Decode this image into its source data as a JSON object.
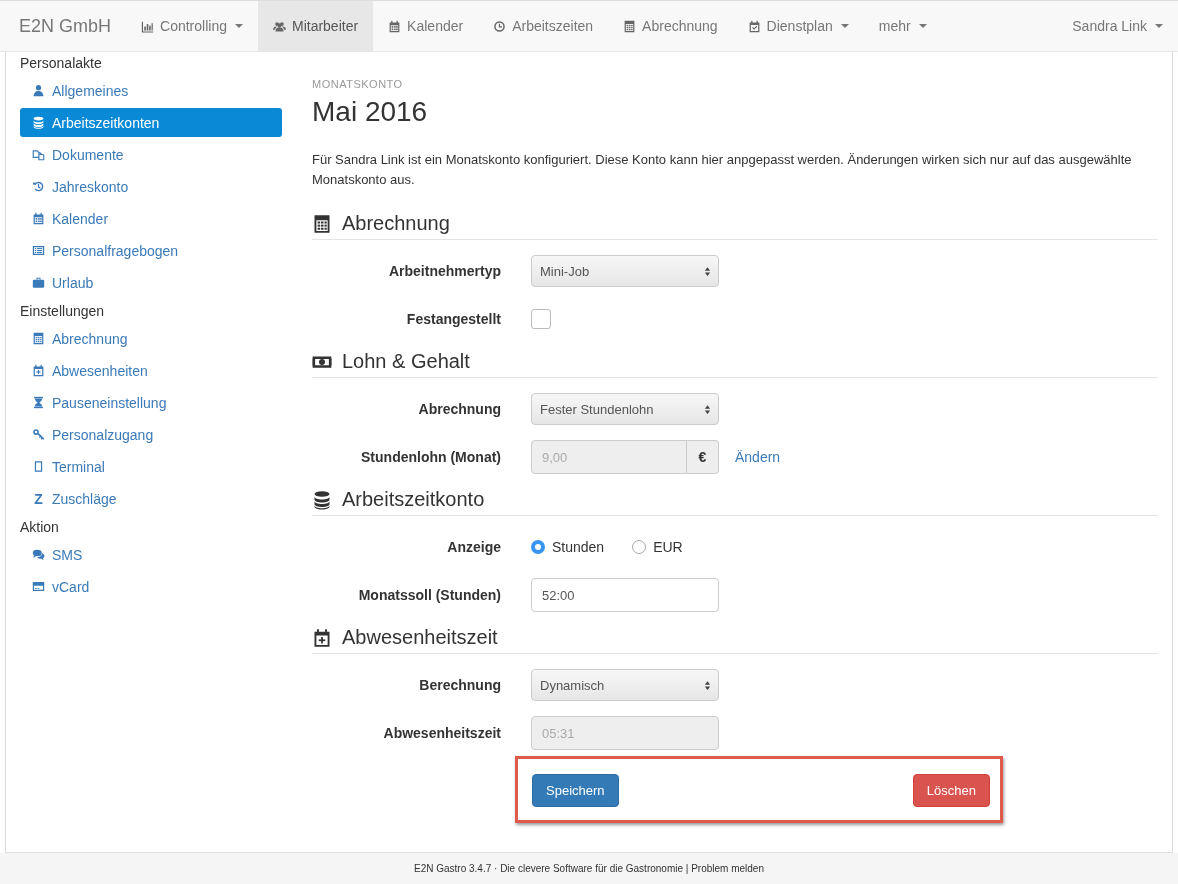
{
  "navbar": {
    "brand": "E2N GmbH",
    "items": [
      {
        "label": "Controlling",
        "dropdown": true,
        "selected": false
      },
      {
        "label": "Mitarbeiter",
        "dropdown": false,
        "selected": true
      },
      {
        "label": "Kalender",
        "dropdown": false,
        "selected": false
      },
      {
        "label": "Arbeitszeiten",
        "dropdown": false,
        "selected": false
      },
      {
        "label": "Abrechnung",
        "dropdown": false,
        "selected": false
      },
      {
        "label": "Dienstplan",
        "dropdown": true,
        "selected": false
      },
      {
        "label": "mehr",
        "dropdown": true,
        "selected": false
      }
    ],
    "user": {
      "label": "Sandra Link",
      "dropdown": true
    }
  },
  "sidebar": {
    "groups": [
      {
        "title": "Personalakte",
        "items": [
          {
            "label": "Allgemeines",
            "selected": false
          },
          {
            "label": "Arbeitszeitkonten",
            "selected": true
          },
          {
            "label": "Dokumente",
            "selected": false
          },
          {
            "label": "Jahreskonto",
            "selected": false
          },
          {
            "label": "Kalender",
            "selected": false
          },
          {
            "label": "Personalfragebogen",
            "selected": false
          },
          {
            "label": "Urlaub",
            "selected": false
          }
        ]
      },
      {
        "title": "Einstellungen",
        "items": [
          {
            "label": "Abrechnung",
            "selected": false
          },
          {
            "label": "Abwesenheiten",
            "selected": false
          },
          {
            "label": "Pauseneinstellung",
            "selected": false
          },
          {
            "label": "Personalzugang",
            "selected": false
          },
          {
            "label": "Terminal",
            "selected": false
          },
          {
            "label": "Zuschläge",
            "selected": false,
            "glyph": "Z"
          }
        ]
      },
      {
        "title": "Aktion",
        "items": [
          {
            "label": "SMS",
            "selected": false
          },
          {
            "label": "vCard",
            "selected": false
          }
        ]
      }
    ]
  },
  "page": {
    "eyebrow": "MONATSKONTO",
    "title": "Mai 2016",
    "intro": "Für Sandra Link ist ein Monatskonto konfiguriert. Diese Konto kann hier anpgepasst werden. Änderungen wirken sich nur auf das ausgewählte Monatskonto aus.",
    "sections": [
      {
        "title": "Abrechnung",
        "fields": [
          {
            "kind": "select",
            "label": "Arbeitnehmertyp",
            "value": "Mini-Job"
          },
          {
            "kind": "checkbox",
            "label": "Festangestellt",
            "checked": false
          }
        ]
      },
      {
        "title": "Lohn & Gehalt",
        "fields": [
          {
            "kind": "select",
            "label": "Abrechnung",
            "value": "Fester Stundenlohn"
          },
          {
            "kind": "input",
            "label": "Stundenlohn (Monat)",
            "value": "9,00",
            "disabled": true,
            "addon": "€",
            "link": "Ändern"
          }
        ]
      },
      {
        "title": "Arbeitszeitkonto",
        "fields": [
          {
            "kind": "radio",
            "label": "Anzeige",
            "options": [
              {
                "label": "Stunden",
                "selected": true
              },
              {
                "label": "EUR",
                "selected": false
              }
            ]
          },
          {
            "kind": "input",
            "label": "Monatssoll (Stunden)",
            "value": "52:00",
            "disabled": false
          }
        ]
      },
      {
        "title": "Abwesenheitszeit",
        "fields": [
          {
            "kind": "select",
            "label": "Berechnung",
            "value": "Dynamisch"
          },
          {
            "kind": "input",
            "label": "Abwesenheitszeit",
            "value": "05:31",
            "disabled": true
          }
        ]
      }
    ]
  },
  "actions": {
    "save": "Speichern",
    "delete": "Löschen"
  },
  "footer": {
    "text": "E2N Gastro 3.4.7 · Die clevere Software für die Gastronomie | Problem melden"
  }
}
